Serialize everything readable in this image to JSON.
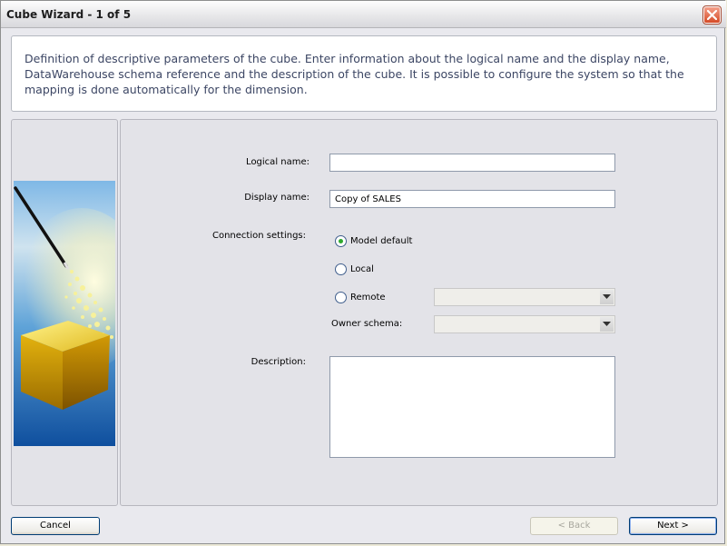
{
  "window": {
    "title": "Cube Wizard - 1 of 5"
  },
  "description": "Definition of descriptive parameters of the cube. Enter information about the logical name and the display name, DataWarehouse schema reference and the description of the cube. It is possible to configure the system so that the mapping is done automatically for the dimension.",
  "form": {
    "logical_name_label": "Logical name:",
    "logical_name_value": "",
    "display_name_label": "Display name:",
    "display_name_value": "Copy of SALES",
    "connection_label": "Connection settings:",
    "connection_options": [
      {
        "label": "Model default",
        "selected": true
      },
      {
        "label": "Local",
        "selected": false
      },
      {
        "label": "Remote",
        "selected": false
      }
    ],
    "remote_select_value": "",
    "owner_schema_label": "Owner schema:",
    "owner_schema_value": "",
    "description_label": "Description:",
    "description_value": ""
  },
  "buttons": {
    "cancel": "Cancel",
    "back": "< Back",
    "next": "Next >"
  },
  "colors": {
    "accent_close": "#d54a26",
    "radio_selected": "#2da82d",
    "description_text": "#3c4664"
  },
  "icons": [
    "close-icon",
    "wizard-wand-cube-image",
    "chevron-down-icon"
  ]
}
